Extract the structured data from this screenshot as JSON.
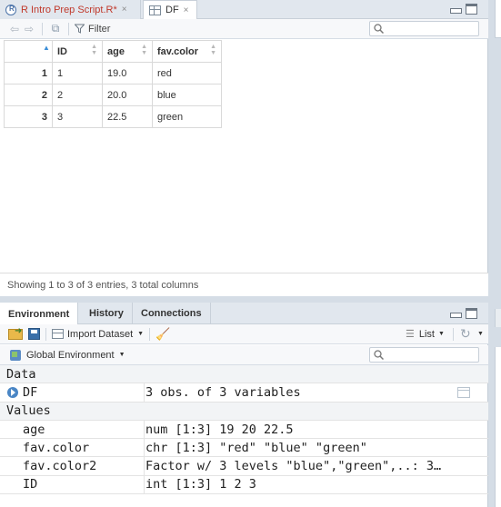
{
  "editor": {
    "tabs": [
      {
        "label": "R Intro Prep Script.R*",
        "close": "×"
      },
      {
        "label": "DF",
        "close": "×"
      }
    ],
    "filter_label": "Filter",
    "columns": [
      "",
      "ID",
      "age",
      "fav.color"
    ],
    "rows": [
      {
        "rownum": "1",
        "id": "1",
        "age": "19.0",
        "color": "red"
      },
      {
        "rownum": "2",
        "id": "2",
        "age": "20.0",
        "color": "blue"
      },
      {
        "rownum": "3",
        "id": "3",
        "age": "22.5",
        "color": "green"
      }
    ],
    "status": "Showing 1 to 3 of 3 entries, 3 total columns"
  },
  "env": {
    "tabs": [
      "Environment",
      "History",
      "Connections"
    ],
    "import_label": "Import Dataset",
    "list_label": "List",
    "scope_label": "Global Environment",
    "data_header": "Data",
    "data_rows": [
      {
        "name": "DF",
        "value": "3 obs. of 3 variables"
      }
    ],
    "values_header": "Values",
    "value_rows": [
      {
        "name": "age",
        "value": "num [1:3] 19 20 22.5"
      },
      {
        "name": "fav.color",
        "value": "chr [1:3] \"red\" \"blue\" \"green\""
      },
      {
        "name": "fav.color2",
        "value": "Factor w/ 3 levels \"blue\",\"green\",..: 3…"
      },
      {
        "name": "ID",
        "value": "int [1:3] 1 2 3"
      }
    ]
  }
}
